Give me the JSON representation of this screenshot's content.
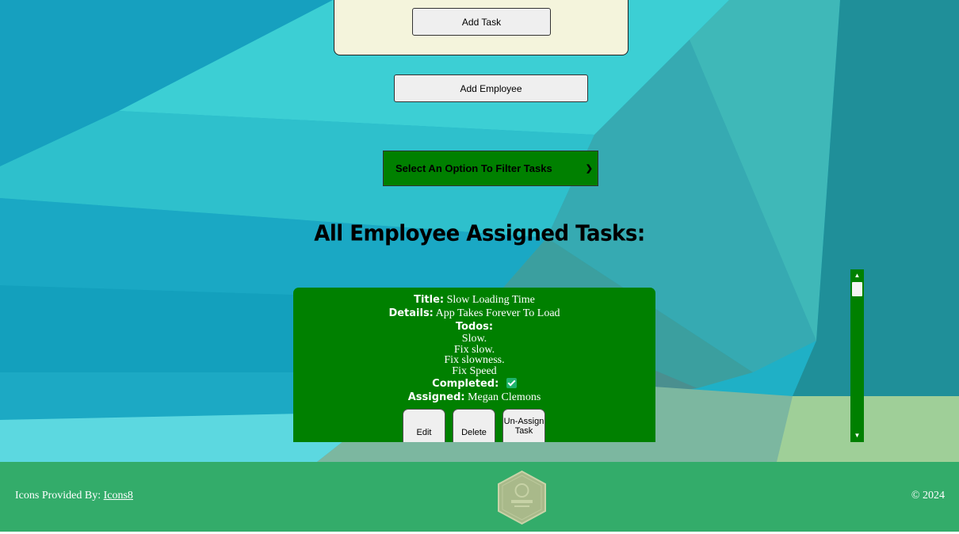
{
  "task_form": {
    "add_task_label": "Add Task"
  },
  "add_employee_label": "Add Employee",
  "filter": {
    "selected": "Select An Option To Filter Tasks"
  },
  "heading": "All Employee Assigned Tasks:",
  "task": {
    "title_label": "Title:",
    "title": "Slow Loading Time",
    "details_label": "Details:",
    "details": "App Takes Forever To Load",
    "todos_label": "Todos:",
    "todos": [
      "Slow.",
      "Fix slow.",
      "Fix slowness.",
      "Fix Speed"
    ],
    "completed_label": "Completed:",
    "completed": true,
    "assigned_label": "Assigned:",
    "assigned": "Megan Clemons",
    "actions": {
      "edit": "Edit",
      "delete": "Delete",
      "unassign": "Un-Assign Task"
    }
  },
  "footer": {
    "icons_prefix": "Icons Provided By:",
    "icons_link": "Icons8",
    "copyright": "© 2024",
    "logo_icon": "issue-insight-logo-icon"
  },
  "colors": {
    "accent_green": "#008000",
    "card_cream": "#f4f4dc",
    "check_green": "#1eb36b"
  }
}
